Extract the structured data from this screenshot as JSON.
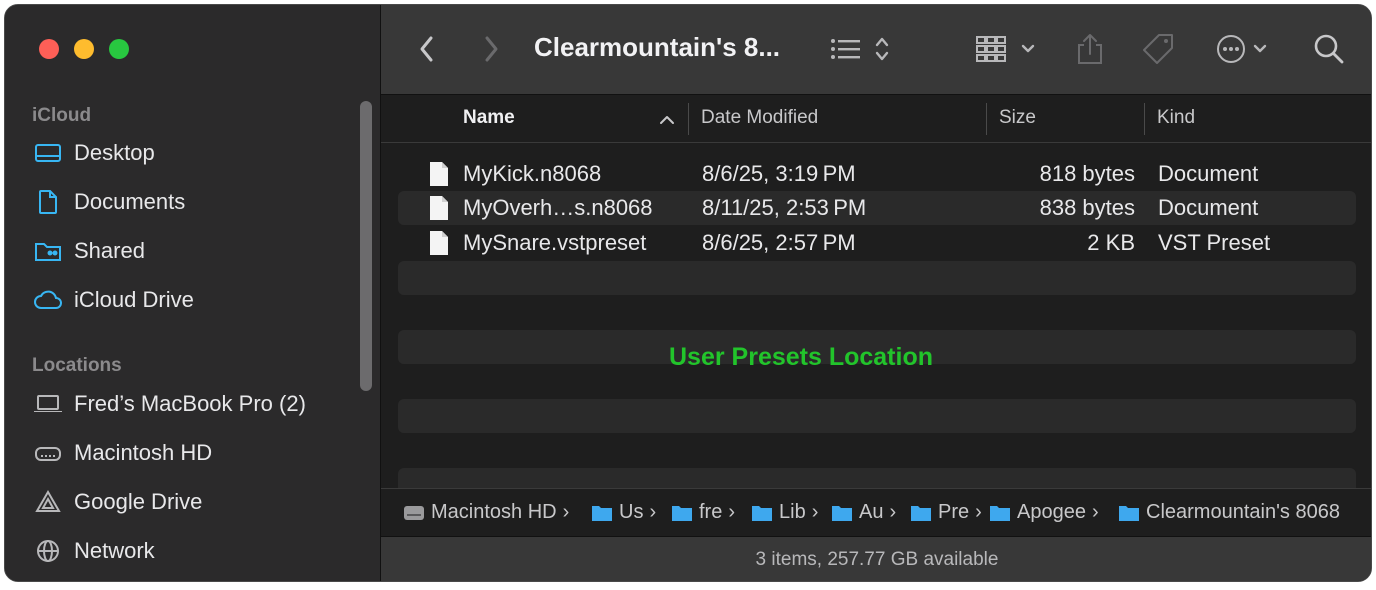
{
  "window": {
    "title": "Clearmountain's 8..."
  },
  "sidebar": {
    "icloud_title": "iCloud",
    "icloud_items": [
      {
        "label": "Desktop",
        "icon": "desktop-icon"
      },
      {
        "label": "Documents",
        "icon": "document-icon"
      },
      {
        "label": "Shared",
        "icon": "shared-folder-icon"
      },
      {
        "label": "iCloud Drive",
        "icon": "cloud-icon"
      }
    ],
    "locations_title": "Locations",
    "location_items": [
      {
        "label": "Fred’s MacBook Pro (2)",
        "icon": "laptop-icon"
      },
      {
        "label": "Macintosh HD",
        "icon": "disk-icon"
      },
      {
        "label": "Google Drive",
        "icon": "google-drive-icon"
      },
      {
        "label": "Network",
        "icon": "globe-icon"
      }
    ]
  },
  "columns": {
    "name": "Name",
    "date": "Date Modified",
    "size": "Size",
    "kind": "Kind"
  },
  "files": [
    {
      "name": "MyKick.n8068",
      "date": "8/6/25, 3:19 PM",
      "size": "818 bytes",
      "kind": "Document"
    },
    {
      "name": "MyOverh…s.n8068",
      "date": "8/11/25, 2:53 PM",
      "size": "838 bytes",
      "kind": "Document"
    },
    {
      "name": "MySnare.vstpreset",
      "date": "8/6/25, 2:57 PM",
      "size": "2 KB",
      "kind": "VST Preset"
    }
  ],
  "annotation": "User Presets Location",
  "path": [
    "Macintosh HD",
    "Us",
    "fre",
    "Lib",
    "Au",
    "Pre",
    "Apogee",
    "Clearmountain's 8068"
  ],
  "status": "3 items, 257.77 GB available",
  "colors": {
    "annotation": "#22c42b",
    "accent_icon": "#38b6f3",
    "folder": "#3ea8ee"
  }
}
